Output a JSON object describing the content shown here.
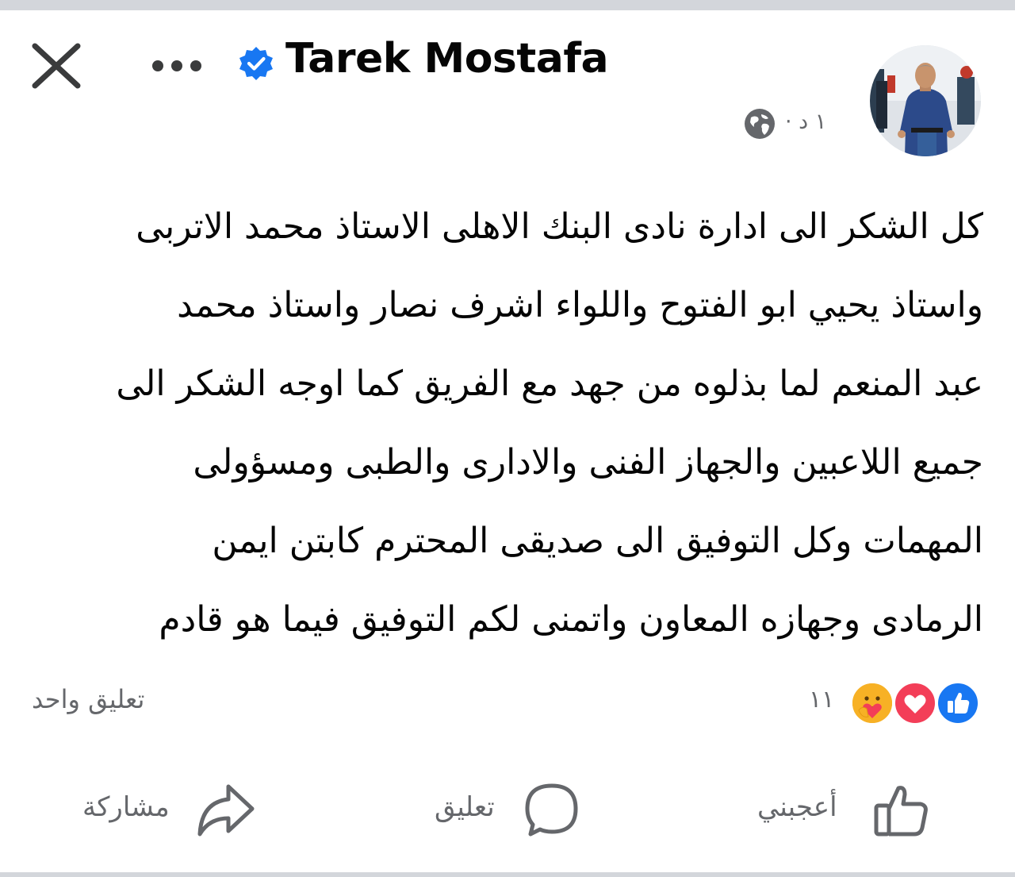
{
  "header": {
    "author_name": "Tarek Mostafa",
    "timestamp": "١ د ·",
    "close_icon": "close-icon",
    "more_icon": "more-options-icon",
    "verified_icon": "verified-badge-icon",
    "privacy_icon": "globe-icon"
  },
  "post": {
    "lines": [
      "كل الشكر الى ادارة نادى البنك الاهلى الاستاذ محمد الاتربى",
      "واستاذ يحيي ابو الفتوح واللواء اشرف نصار واستاذ محمد",
      "عبد المنعم لما بذلوه من جهد مع الفريق كما اوجه الشكر الى",
      "جميع اللاعبين والجهاز الفنى والادارى والطبى ومسؤولى",
      "المهمات وكل التوفيق الى صديقى المحترم كابتن ايمن",
      "الرمادى وجهازه المعاون واتمنى لكم التوفيق فيما هو قادم"
    ]
  },
  "stats": {
    "reaction_count": "١١",
    "comment_count": "تعليق واحد",
    "reaction_icons": [
      "like-reaction-icon",
      "love-reaction-icon",
      "care-reaction-icon"
    ]
  },
  "actions": {
    "like_label": "أعجبني",
    "comment_label": "تعليق",
    "share_label": "مشاركة"
  },
  "colors": {
    "accent": "#1877f2",
    "love": "#f33e58",
    "care": "#f7b125",
    "secondary_text": "#65676b",
    "divider": "#d3d6db"
  }
}
